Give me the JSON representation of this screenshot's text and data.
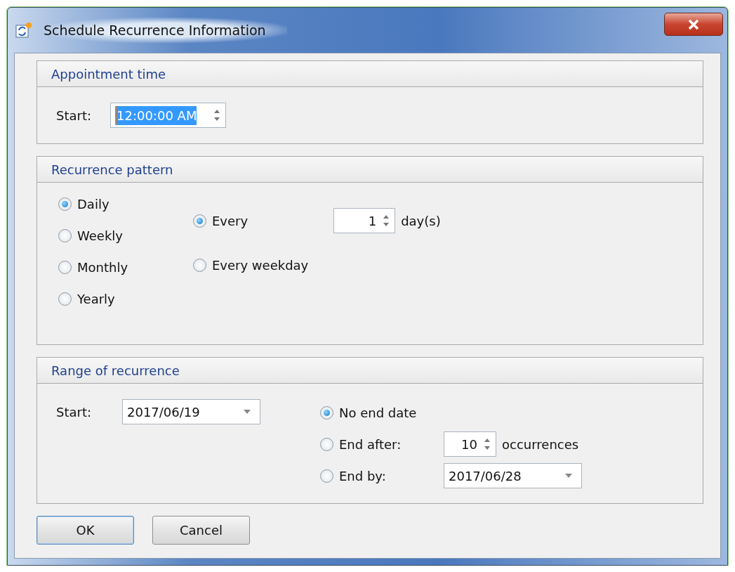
{
  "window": {
    "title": "Schedule Recurrence Information"
  },
  "appointment_time": {
    "title": "Appointment time",
    "start_label": "Start:",
    "start_value": "12:00:00 AM",
    "value_selected": true
  },
  "recurrence_pattern": {
    "title": "Recurrence pattern",
    "frequencies": [
      {
        "label": "Daily",
        "selected": true
      },
      {
        "label": "Weekly",
        "selected": false
      },
      {
        "label": "Monthly",
        "selected": false
      },
      {
        "label": "Yearly",
        "selected": false
      }
    ],
    "options": [
      {
        "kind": "spin",
        "label": "Every",
        "selected": true,
        "value": "1",
        "unit": "day(s)"
      },
      {
        "kind": "plain",
        "label": "Every weekday",
        "selected": false
      }
    ]
  },
  "range_of_recurrence": {
    "title": "Range of recurrence",
    "start_label": "Start:",
    "start_value": "2017/06/19",
    "ends": [
      {
        "kind": "plain",
        "label": "No end date",
        "selected": true
      },
      {
        "kind": "spin",
        "label": "End after:",
        "selected": false,
        "value": "10",
        "unit": "occurrences"
      },
      {
        "kind": "date",
        "label": "End by:",
        "selected": false,
        "value": "2017/06/28"
      }
    ]
  },
  "buttons": [
    {
      "label": "OK",
      "default": true
    },
    {
      "label": "Cancel",
      "default": false
    }
  ]
}
